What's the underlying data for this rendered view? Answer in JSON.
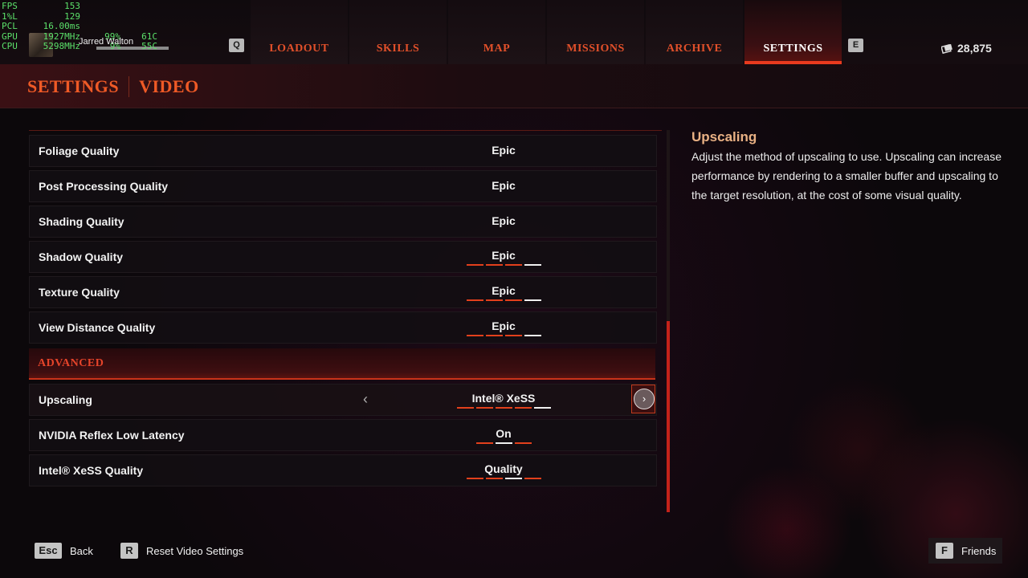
{
  "overlay": {
    "rows": [
      {
        "k": "FPS",
        "v": "153",
        "v2": "",
        "v3": ""
      },
      {
        "k": "1%L",
        "v": "129",
        "v2": "",
        "v3": ""
      },
      {
        "k": "PCL",
        "v": "16.00ms",
        "v2": "",
        "v3": ""
      },
      {
        "k": "GPU",
        "v": "1927MHz",
        "v2": "99%",
        "v3": "61C"
      },
      {
        "k": "CPU",
        "v": "5298MHz",
        "v2": "9%",
        "v3": "55C"
      }
    ],
    "player_name": "Jarred Walton"
  },
  "nav": {
    "left_key": "Q",
    "right_key": "E",
    "tabs": [
      {
        "label": "LOADOUT",
        "active": false
      },
      {
        "label": "SKILLS",
        "active": false
      },
      {
        "label": "MAP",
        "active": false
      },
      {
        "label": "MISSIONS",
        "active": false
      },
      {
        "label": "ARCHIVE",
        "active": false
      },
      {
        "label": "SETTINGS",
        "active": true
      }
    ],
    "currency": "28,875"
  },
  "header": {
    "section": "SETTINGS",
    "page": "VIDEO"
  },
  "settings": [
    {
      "label": "Foliage Quality",
      "value": "Epic",
      "ticks": 0,
      "filled": 0
    },
    {
      "label": "Post Processing Quality",
      "value": "Epic",
      "ticks": 0,
      "filled": 0
    },
    {
      "label": "Shading Quality",
      "value": "Epic",
      "ticks": 0,
      "filled": 0
    },
    {
      "label": "Shadow Quality",
      "value": "Epic",
      "ticks": 4,
      "filled": 3
    },
    {
      "label": "Texture Quality",
      "value": "Epic",
      "ticks": 4,
      "filled": 3
    },
    {
      "label": "View Distance Quality",
      "value": "Epic",
      "ticks": 4,
      "filled": 3
    }
  ],
  "advanced": {
    "label": "ADVANCED",
    "settings": [
      {
        "label": "Upscaling",
        "value": "Intel® XeSS",
        "ticks": 5,
        "filled": 4,
        "selected": true
      },
      {
        "label": "NVIDIA Reflex Low Latency",
        "value": "On",
        "ticks": 3,
        "filled": 2,
        "current": 1
      },
      {
        "label": "Intel® XeSS Quality",
        "value": "Quality",
        "ticks": 4,
        "filled": 3,
        "current": 2
      }
    ]
  },
  "scroll": {
    "position": 0.5
  },
  "description": {
    "title": "Upscaling",
    "body": "Adjust the method of upscaling to use.  Upscaling can increase performance by rendering to a smaller buffer and upscaling to the target resolution, at the cost of some visual quality."
  },
  "footer": {
    "back_key": "Esc",
    "back_label": "Back",
    "reset_key": "R",
    "reset_label": "Reset Video Settings",
    "friends_key": "F",
    "friends_label": "Friends"
  },
  "colors": {
    "accent": "#e83a1e",
    "tick_filled": "#e2401c",
    "tick_empty": "#f0f0f0",
    "desc_title": "#e9b184"
  }
}
